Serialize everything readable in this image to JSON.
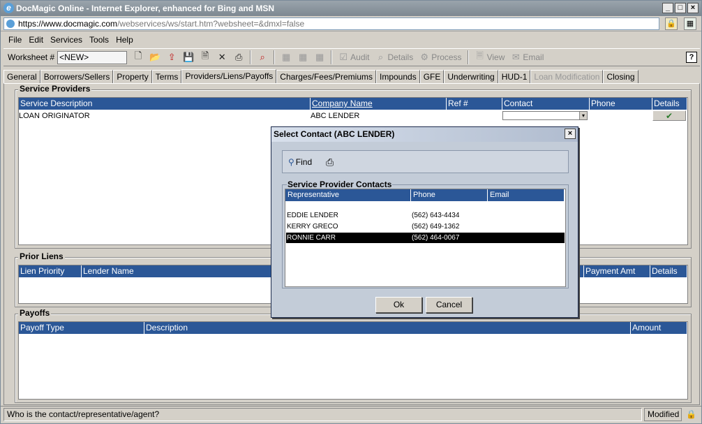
{
  "browser": {
    "title": "DocMagic Online - Internet Explorer, enhanced for Bing and MSN",
    "url_prefix": "https://www.",
    "url_domain": "docmagic.com",
    "url_path": "/webservices/ws/start.htm?websheet=&dmxl=false",
    "window_buttons": [
      "_",
      "□",
      "×"
    ]
  },
  "menu": [
    "File",
    "Edit",
    "Services",
    "Tools",
    "Help"
  ],
  "toolbar": {
    "worksheet_label": "Worksheet #",
    "worksheet_value": "<NEW>",
    "audit_label": "Audit",
    "details_label": "Details",
    "process_label": "Process",
    "view_label": "View",
    "email_label": "Email"
  },
  "tabs": [
    "General",
    "Borrowers/Sellers",
    "Property",
    "Terms",
    "Providers/Liens/Payoffs",
    "Charges/Fees/Premiums",
    "Impounds",
    "GFE",
    "Underwriting",
    "HUD-1",
    "Loan Modification",
    "Closing"
  ],
  "service_providers": {
    "title": "Service Providers",
    "columns": [
      "Service Description",
      "Company Name",
      "Ref #",
      "Contact",
      "Phone",
      "Details"
    ],
    "rows": [
      {
        "description": "LOAN ORIGINATOR",
        "company": "ABC LENDER",
        "ref": "",
        "contact": "",
        "phone": ""
      }
    ]
  },
  "prior_liens": {
    "title": "Prior Liens",
    "columns": [
      "Lien Priority",
      "Lender Name",
      "Payment Amt",
      "Details"
    ]
  },
  "payoffs": {
    "title": "Payoffs",
    "columns": [
      "Payoff Type",
      "Description",
      "Amount"
    ]
  },
  "status": {
    "message": "Who is the contact/representative/agent?",
    "state": "Modified"
  },
  "dialog": {
    "title": "Select Contact (ABC LENDER)",
    "find_label": "Find",
    "group_title": "Service Provider Contacts",
    "columns": [
      "Representative",
      "Phone",
      "Email"
    ],
    "contacts": [
      {
        "name": "EDDIE LENDER",
        "phone": "(562) 643-4434",
        "email": ""
      },
      {
        "name": "KERRY GRECO",
        "phone": "(562) 649-1362",
        "email": ""
      },
      {
        "name": "RONNIE CARR",
        "phone": "(562) 464-0067",
        "email": ""
      }
    ],
    "selected_index": 2,
    "ok_label": "Ok",
    "cancel_label": "Cancel"
  }
}
